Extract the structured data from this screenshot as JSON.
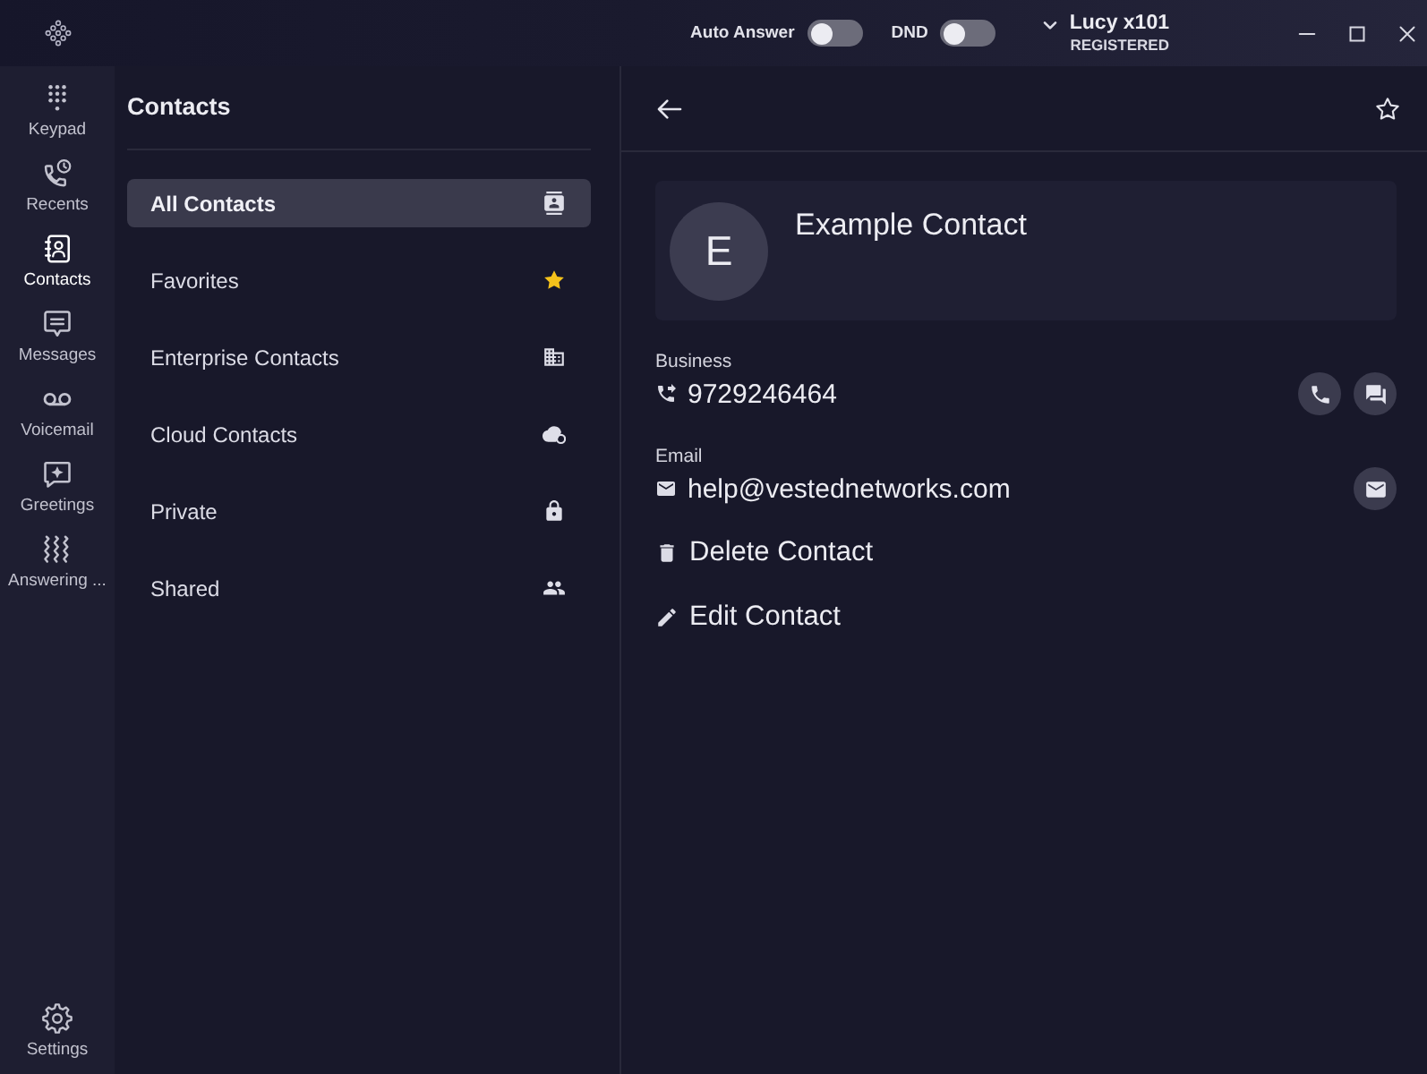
{
  "title_bar": {
    "toggles": [
      {
        "label": "Auto Answer",
        "on": false
      },
      {
        "label": "DND",
        "on": false
      }
    ],
    "account": {
      "name": "Lucy x101",
      "status": "REGISTERED"
    }
  },
  "nav": {
    "items": [
      {
        "label": "Keypad",
        "kind": "keypad",
        "selected": false
      },
      {
        "label": "Recents",
        "kind": "recents",
        "selected": false
      },
      {
        "label": "Contacts",
        "kind": "contacts",
        "selected": true
      },
      {
        "label": "Messages",
        "kind": "messages",
        "selected": false
      },
      {
        "label": "Voicemail",
        "kind": "voicemail",
        "selected": false
      },
      {
        "label": "Greetings",
        "kind": "greetings",
        "selected": false
      },
      {
        "label": "Answering ...",
        "kind": "answering",
        "selected": false
      }
    ],
    "footer": {
      "label": "Settings"
    }
  },
  "contacts_panel": {
    "title": "Contacts",
    "items": [
      {
        "label": "All Contacts",
        "kind": "all",
        "selected": true
      },
      {
        "label": "Favorites",
        "kind": "favorites",
        "selected": false
      },
      {
        "label": "Enterprise Contacts",
        "kind": "enterprise",
        "selected": false
      },
      {
        "label": "Cloud Contacts",
        "kind": "cloud",
        "selected": false
      },
      {
        "label": "Private",
        "kind": "private",
        "selected": false
      },
      {
        "label": "Shared",
        "kind": "shared",
        "selected": false
      }
    ]
  },
  "detail": {
    "favorite": false,
    "contact": {
      "initial": "E",
      "name": "Example Contact"
    },
    "fields": [
      {
        "label": "Business",
        "kind": "phone",
        "value": "9729246464",
        "actions": [
          {
            "kind": "call"
          },
          {
            "kind": "chat"
          }
        ]
      },
      {
        "label": "Email",
        "kind": "email",
        "value": "help@vestednetworks.com",
        "actions": [
          {
            "kind": "mail"
          }
        ]
      }
    ],
    "actions": [
      {
        "label": "Delete Contact",
        "kind": "delete"
      },
      {
        "label": "Edit Contact",
        "kind": "edit"
      }
    ]
  }
}
